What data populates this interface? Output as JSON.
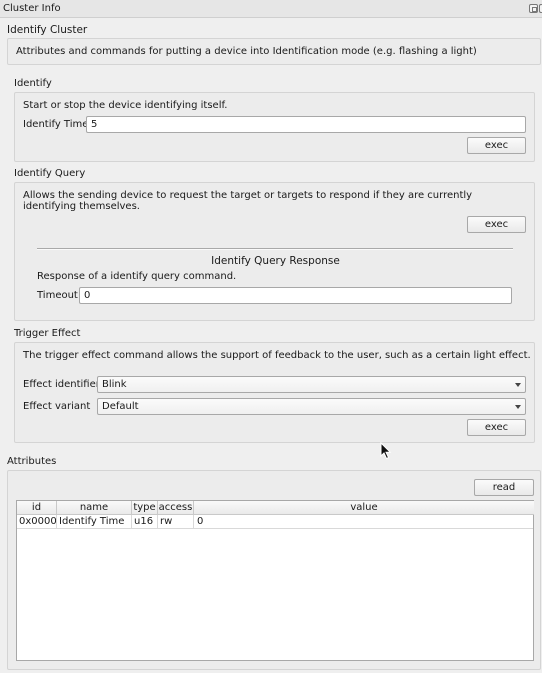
{
  "window": {
    "title": "Cluster Info"
  },
  "cluster": {
    "heading": "Identify Cluster",
    "description": "Attributes and commands for putting a device into Identification mode (e.g. flashing a light)"
  },
  "identify": {
    "heading": "Identify",
    "description": "Start or stop the device identifying itself.",
    "time_label": "Identify Time",
    "time_value": "5",
    "exec_label": "exec"
  },
  "identify_query": {
    "heading": "Identify Query",
    "description": "Allows the sending device to request the target or targets to respond if they are currently identifying themselves.",
    "exec_label": "exec",
    "response_heading": "Identify Query Response",
    "response_description": "Response of a identify query command.",
    "timeout_label": "Timeout",
    "timeout_value": "0"
  },
  "trigger_effect": {
    "heading": "Trigger Effect",
    "description": "The trigger effect command allows the support of feedback to the user, such as a certain light effect.",
    "effect_identifier_label": "Effect identifier",
    "effect_identifier_value": "Blink",
    "effect_variant_label": "Effect variant",
    "effect_variant_value": "Default",
    "exec_label": "exec"
  },
  "attributes": {
    "heading": "Attributes",
    "read_label": "read",
    "columns": [
      "id",
      "name",
      "type",
      "access",
      "value"
    ],
    "rows": [
      {
        "id": "0x0000",
        "name": "Identify Time",
        "type": "u16",
        "access": "rw",
        "value": "0"
      }
    ]
  }
}
